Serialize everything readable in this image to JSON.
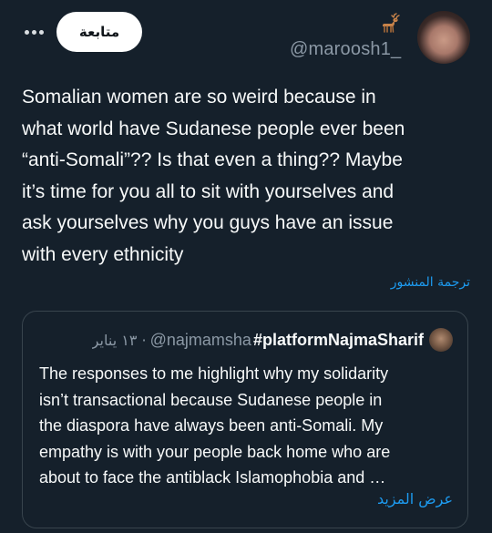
{
  "header": {
    "follow_label": "متابعة",
    "handle": "@maroosh1_",
    "badge_emoji": "🦌",
    "more_icon": "more-horizontal-icon"
  },
  "tweet": {
    "text": "Somalian women are so weird because in\nwhat world have Sudanese people ever been\n“anti-Somali”?? Is that even a thing?? Maybe\nit’s time for you all to sit with yourselves and\nask yourselves why you guys have an issue\nwith every ethnicity",
    "translate_label": "ترجمة المنشور"
  },
  "quote": {
    "author_name": "#platformNajmaSharif",
    "author_handle": "@najmamsha",
    "date": "· ١٣ يناير",
    "text": "The responses to me highlight why my solidarity\nisn’t transactional because Sudanese people in\nthe diaspora have always been anti-Somali. My\nempathy is with your people back home who are\nabout to face the antiblack Islamophobia and …",
    "show_more_label": "عرض المزيد"
  },
  "colors": {
    "background": "#15202b",
    "text": "#f7f9f9",
    "secondary": "#8b98a5",
    "accent": "#1d9bf0",
    "border": "#38444d"
  }
}
